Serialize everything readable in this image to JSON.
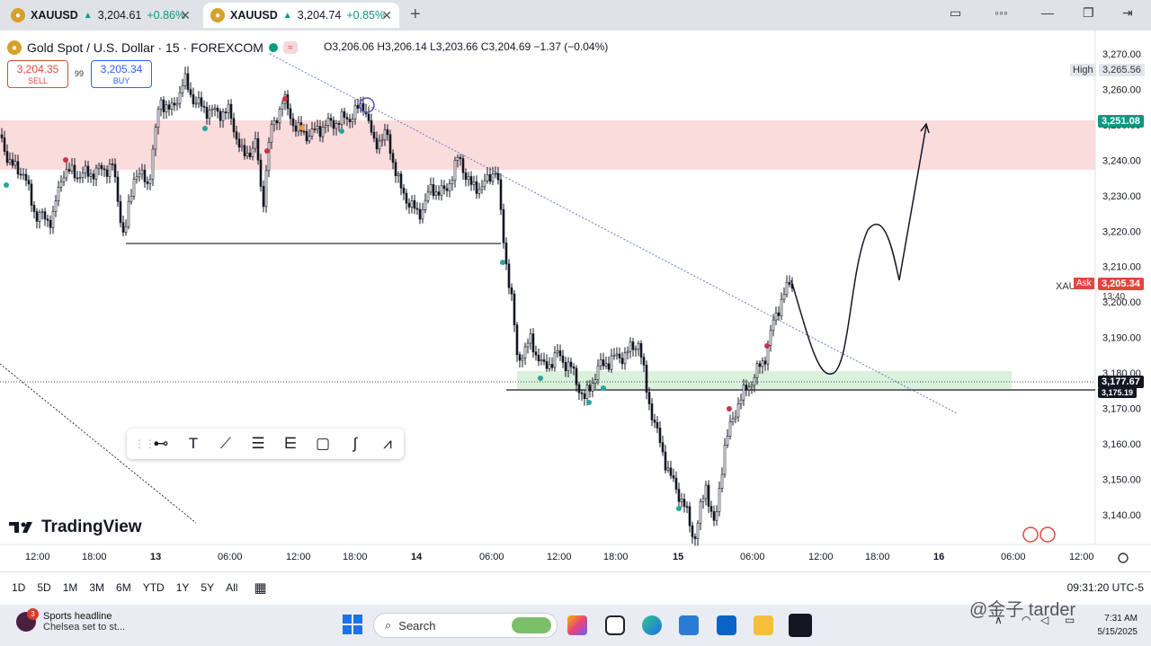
{
  "tabs": [
    {
      "symbol": "XAUUSD",
      "price": "3,204.61",
      "change": "+0.86%"
    },
    {
      "symbol": "XAUUSD",
      "price": "3,204.74",
      "change": "+0.85%"
    }
  ],
  "legend": {
    "title": "Gold Spot / U.S. Dollar · 15 · FOREXCOM",
    "ohlc": "O3,206.06  H3,206.14  L3,203.66  C3,204.69  −1.37 (−0.04%)"
  },
  "trade": {
    "sell_price": "3,204.35",
    "sell_label": "SELL",
    "spread": "99",
    "buy_price": "3,205.34",
    "buy_label": "BUY"
  },
  "price_axis": {
    "ticks": [
      "3,270.00",
      "3,260.00",
      "3,250.00",
      "3,240.00",
      "3,230.00",
      "3,220.00",
      "3,210.00",
      "3,200.00",
      "3,190.00",
      "3,180.00",
      "3,170.00",
      "3,160.00",
      "3,150.00",
      "3,140.00"
    ],
    "high_label": "High",
    "high_value": "3,265.56",
    "zone_top_tag": "3,251.08",
    "ask_symbol": "XAU",
    "ask_label": "Ask",
    "ask_value": "3,205.34",
    "countdown": "13:40",
    "support_tag": "3,177.67",
    "support_tag2": "3,175.19"
  },
  "time_axis": [
    "12:00",
    "18:00",
    "13",
    "06:00",
    "12:00",
    "18:00",
    "14",
    "06:00",
    "12:00",
    "18:00",
    "15",
    "06:00",
    "12:00",
    "18:00",
    "16",
    "06:00",
    "12:00"
  ],
  "branding": "TradingView",
  "ranges": [
    "1D",
    "5D",
    "1M",
    "3M",
    "6M",
    "YTD",
    "1Y",
    "5Y",
    "All"
  ],
  "clock": "09:31:20 UTC-5",
  "taskbar": {
    "news_badge": "3",
    "news_title": "Sports headline",
    "news_sub": "Chelsea set to st...",
    "search": "Search",
    "time": "7:31 AM",
    "date": "5/15/2025"
  },
  "watermark": "@金子 tarder",
  "colors": {
    "up": "#089981",
    "down": "#e0473f",
    "accent": "#2962ff",
    "zone_red": "#fbdcdd",
    "zone_green": "#daf1dc"
  }
}
